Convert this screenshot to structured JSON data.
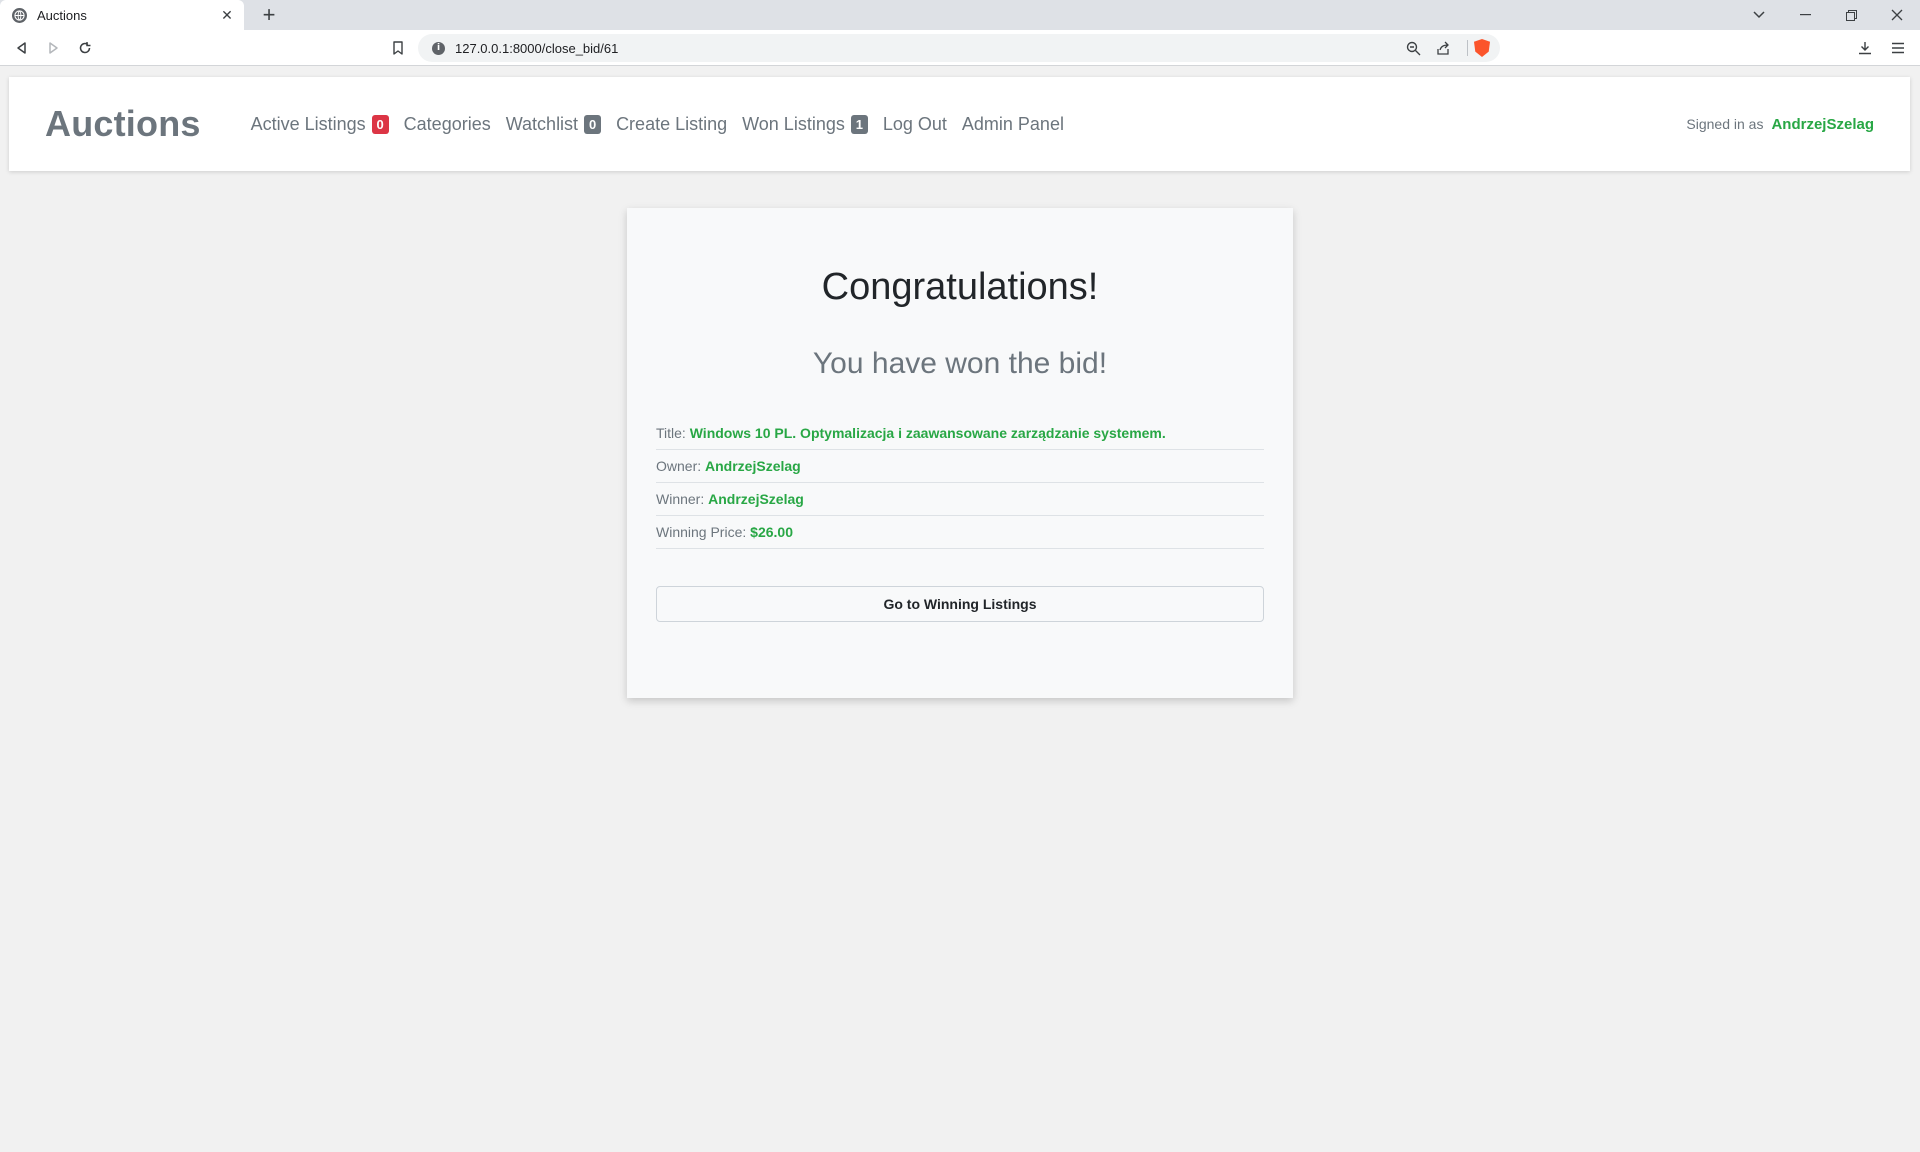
{
  "browser": {
    "tab_title": "Auctions",
    "new_tab": "+",
    "close_glyph": "✕",
    "url": "127.0.0.1:8000/close_bid/61",
    "info_glyph": "i",
    "window": {
      "chevron": "⌄",
      "minimize": "—",
      "restore": "❐",
      "close": "✕"
    },
    "icons": [
      "globe-icon",
      "back-icon",
      "forward-icon",
      "reload-icon",
      "bookmark-icon",
      "zoom-icon",
      "share-icon",
      "brave-shield-icon",
      "download-icon",
      "menu-icon"
    ]
  },
  "navbar": {
    "brand": "Auctions",
    "links": {
      "active_listings": "Active Listings",
      "active_listings_count": "0",
      "categories": "Categories",
      "watchlist": "Watchlist",
      "watchlist_count": "0",
      "create_listing": "Create Listing",
      "won_listings": "Won Listings",
      "won_listings_count": "1",
      "log_out": "Log Out",
      "admin_panel": "Admin Panel"
    },
    "signed_in_label": "Signed in as",
    "username": "AndrzejSzelag"
  },
  "card": {
    "title": "Congratulations!",
    "subtitle": "You have won the bid!",
    "details": {
      "title_label": "Title:",
      "title_value": "Windows 10 PL. Optymalizacja i zaawansowane zarządzanie systemem.",
      "owner_label": "Owner:",
      "owner_value": "AndrzejSzelag",
      "winner_label": "Winner:",
      "winner_value": "AndrzejSzelag",
      "price_label": "Winning Price:",
      "price_value": "$26.00"
    },
    "button_label": "Go to Winning Listings"
  },
  "colors": {
    "accent_green": "#28a745",
    "badge_red": "#dc3545",
    "badge_grey": "#6c757d",
    "brave_orange": "#fb542b"
  }
}
